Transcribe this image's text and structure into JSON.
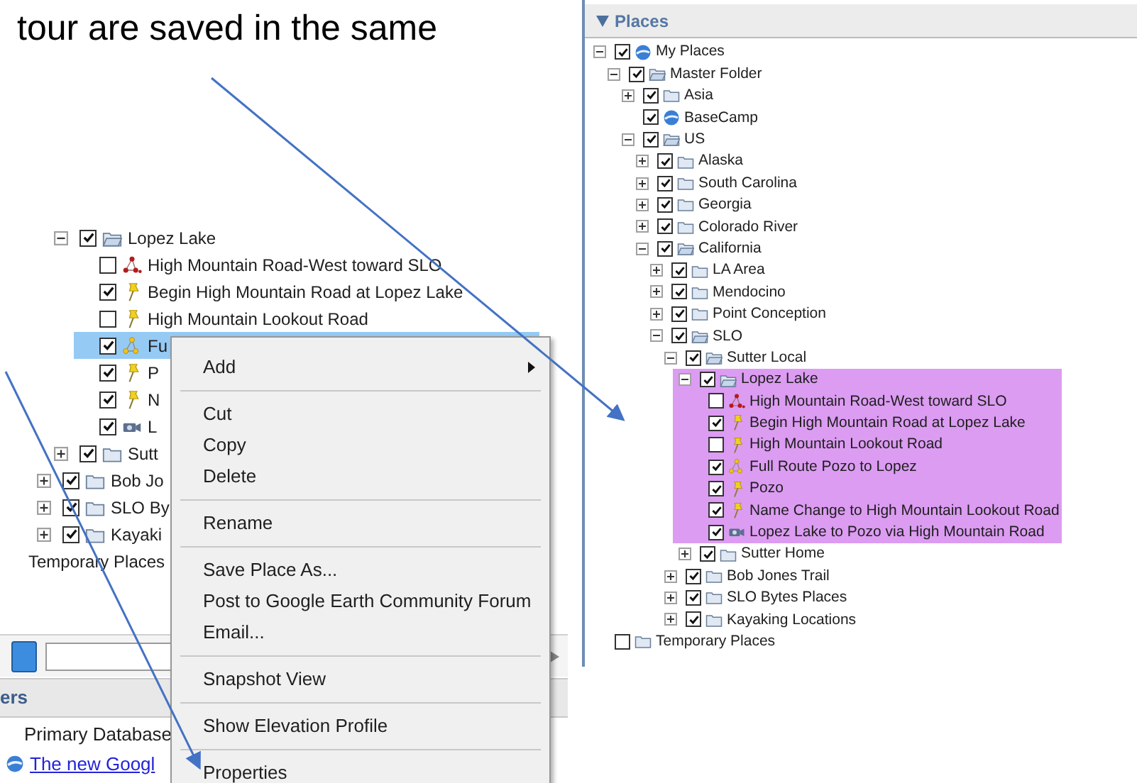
{
  "heading": "tour are saved in the same",
  "left_panel": {
    "inner_rows": [
      {
        "label": "Lopez Lake",
        "kind": "open-folder",
        "checked": true,
        "expanded": true,
        "selected": false,
        "children": [
          {
            "label": "High Mountain Road-West toward SLO",
            "kind": "path-red",
            "checked": false,
            "selected": false
          },
          {
            "label": "Begin High Mountain Road at Lopez Lake",
            "kind": "pin",
            "checked": true,
            "selected": false
          },
          {
            "label": "High Mountain Lookout Road",
            "kind": "pin",
            "checked": false,
            "selected": false
          },
          {
            "label": "Fu",
            "kind": "path-yellow",
            "checked": true,
            "selected": true
          },
          {
            "label": "P",
            "kind": "pin",
            "checked": true,
            "selected": false
          },
          {
            "label": "N",
            "kind": "pin",
            "checked": true,
            "selected": false
          },
          {
            "label": "L",
            "kind": "tour",
            "checked": true,
            "selected": false
          }
        ]
      },
      {
        "label": "Sutt",
        "kind": "folder",
        "checked": true,
        "expanded": false,
        "selected": false
      }
    ],
    "outer_rows": [
      {
        "label": "Bob Jo",
        "kind": "folder",
        "checked": true,
        "expanded": false,
        "selected": false
      },
      {
        "label": "SLO By",
        "kind": "folder",
        "checked": true,
        "expanded": false,
        "selected": false
      },
      {
        "label": "Kayaki",
        "kind": "folder",
        "checked": true,
        "expanded": false,
        "selected": false
      }
    ],
    "temporary_row": "Temporary Places",
    "layers_header": "ers",
    "layers": [
      {
        "label": "Primary Database",
        "kind": "text"
      },
      {
        "label": "The new Googl",
        "kind": "link"
      }
    ]
  },
  "context_menu": [
    {
      "kind": "item",
      "label": "Add",
      "submenu": true
    },
    {
      "kind": "separator"
    },
    {
      "kind": "item",
      "label": "Cut",
      "submenu": false
    },
    {
      "kind": "item",
      "label": "Copy",
      "submenu": false
    },
    {
      "kind": "item",
      "label": "Delete",
      "submenu": false
    },
    {
      "kind": "separator"
    },
    {
      "kind": "item",
      "label": "Rename",
      "submenu": false
    },
    {
      "kind": "separator"
    },
    {
      "kind": "item",
      "label": "Save Place As...",
      "submenu": false
    },
    {
      "kind": "item",
      "label": "Post to Google Earth Community Forum",
      "submenu": false
    },
    {
      "kind": "item",
      "label": "Email...",
      "submenu": false
    },
    {
      "kind": "separator"
    },
    {
      "kind": "item",
      "label": "Snapshot View",
      "submenu": false
    },
    {
      "kind": "separator"
    },
    {
      "kind": "item",
      "label": "Show Elevation Profile",
      "submenu": false
    },
    {
      "kind": "separator"
    },
    {
      "kind": "item",
      "label": "Properties",
      "submenu": false
    }
  ],
  "places_panel": {
    "title": "Places",
    "expanded": true,
    "tree": [
      {
        "label": "My Places",
        "kind": "globe",
        "checked": true,
        "expanded": true,
        "children": [
          {
            "label": "Master Folder",
            "kind": "open-folder",
            "checked": true,
            "expanded": true,
            "children": [
              {
                "label": "Asia",
                "kind": "folder",
                "checked": true,
                "expanded": false
              },
              {
                "label": "BaseCamp",
                "kind": "globe",
                "checked": true
              },
              {
                "label": "US",
                "kind": "open-folder",
                "checked": true,
                "expanded": true,
                "children": [
                  {
                    "label": "Alaska",
                    "kind": "folder",
                    "checked": true,
                    "expanded": false
                  },
                  {
                    "label": "South Carolina",
                    "kind": "folder",
                    "checked": true,
                    "expanded": false
                  },
                  {
                    "label": "Georgia",
                    "kind": "folder",
                    "checked": true,
                    "expanded": false
                  },
                  {
                    "label": "Colorado River",
                    "kind": "folder",
                    "checked": true,
                    "expanded": false
                  },
                  {
                    "label": "California",
                    "kind": "open-folder",
                    "checked": true,
                    "expanded": true,
                    "children": [
                      {
                        "label": "LA Area",
                        "kind": "folder",
                        "checked": true,
                        "expanded": false
                      },
                      {
                        "label": "Mendocino",
                        "kind": "folder",
                        "checked": true,
                        "expanded": false
                      },
                      {
                        "label": "Point Conception",
                        "kind": "folder",
                        "checked": true,
                        "expanded": false
                      },
                      {
                        "label": "SLO",
                        "kind": "open-folder",
                        "checked": true,
                        "expanded": true,
                        "children": [
                          {
                            "label": "Sutter Local",
                            "kind": "open-folder",
                            "checked": true,
                            "expanded": true,
                            "children": [
                              {
                                "label": "Lopez Lake",
                                "kind": "open-folder",
                                "checked": true,
                                "expanded": true,
                                "highlighted": true,
                                "children": [
                                  {
                                    "label": "High Mountain Road-West toward SLO",
                                    "kind": "path-red",
                                    "checked": false
                                  },
                                  {
                                    "label": "Begin High Mountain Road at Lopez Lake",
                                    "kind": "pin",
                                    "checked": true
                                  },
                                  {
                                    "label": "High Mountain Lookout Road",
                                    "kind": "pin",
                                    "checked": false
                                  },
                                  {
                                    "label": "Full Route Pozo to Lopez",
                                    "kind": "path-yellow",
                                    "checked": true
                                  },
                                  {
                                    "label": "Pozo",
                                    "kind": "pin",
                                    "checked": true
                                  },
                                  {
                                    "label": "Name Change to High Mountain Lookout Road",
                                    "kind": "pin",
                                    "checked": true
                                  },
                                  {
                                    "label": "Lopez Lake to Pozo via High Mountain Road",
                                    "kind": "tour",
                                    "checked": true
                                  }
                                ]
                              },
                              {
                                "label": "Sutter Home",
                                "kind": "folder",
                                "checked": true,
                                "expanded": false
                              }
                            ]
                          },
                          {
                            "label": "Bob Jones Trail",
                            "kind": "folder",
                            "checked": true,
                            "expanded": false
                          },
                          {
                            "label": "SLO Bytes Places",
                            "kind": "folder",
                            "checked": true,
                            "expanded": false
                          },
                          {
                            "label": "Kayaking Locations",
                            "kind": "folder",
                            "checked": true,
                            "expanded": false
                          }
                        ]
                      }
                    ]
                  }
                ]
              }
            ]
          }
        ]
      },
      {
        "label": "Temporary Places",
        "kind": "folder",
        "checked": false
      }
    ]
  }
}
